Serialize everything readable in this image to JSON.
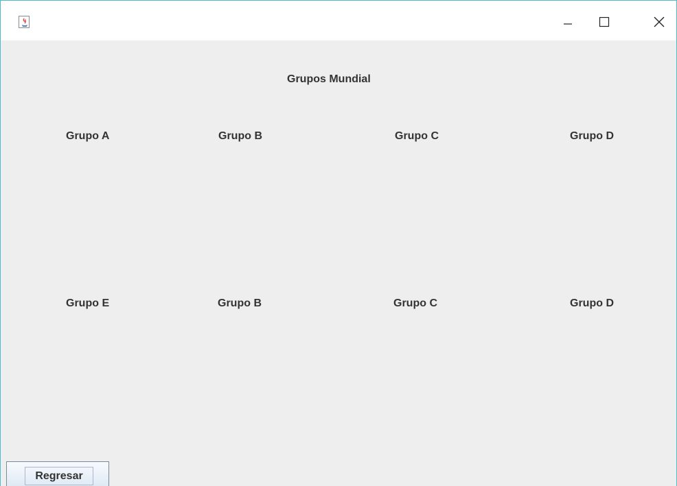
{
  "window": {
    "app_icon": "java-coffee-icon",
    "controls": {
      "minimize_icon": "minimize-icon",
      "maximize_icon": "maximize-icon",
      "close_icon": "close-icon"
    }
  },
  "main": {
    "title": "Grupos Mundial",
    "groups_row1": [
      "Grupo A",
      "Grupo B",
      "Grupo C",
      "Grupo D"
    ],
    "groups_row2": [
      "Grupo E",
      "Grupo B",
      "Grupo C",
      "Grupo D"
    ]
  },
  "footer": {
    "back_label": "Regresar"
  },
  "colors": {
    "window_border": "#4fb8c9",
    "content_bg": "#eeeeee",
    "label_text": "#333333"
  }
}
